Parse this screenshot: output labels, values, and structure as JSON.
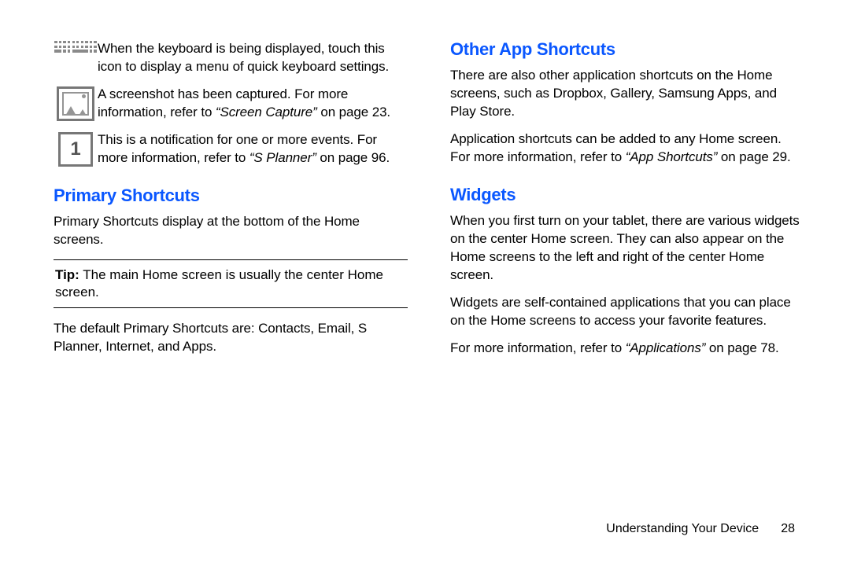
{
  "left": {
    "icons": [
      {
        "name": "keyboard-icon",
        "text_a": "When the keyboard is being displayed, touch this icon to display a menu of quick keyboard settings."
      },
      {
        "name": "screenshot-icon",
        "text_a": "A screenshot has been captured. For more information, refer to ",
        "ref": "“Screen Capture”",
        "text_b": " on page 23."
      },
      {
        "name": "event-icon",
        "num": "1",
        "text_a": "This is a notification for one or more events. For more information, refer to ",
        "ref": "“S Planner”",
        "text_b": " on page 96."
      }
    ],
    "heading": "Primary Shortcuts",
    "p1": "Primary Shortcuts display at the bottom of the Home screens.",
    "tip_label": "Tip:",
    "tip_body": " The main Home screen is usually the center Home screen.",
    "p2": "The default Primary Shortcuts are: Contacts, Email, S Planner, Internet, and Apps."
  },
  "right": {
    "h1": "Other App Shortcuts",
    "p1": "There are also other application shortcuts on the Home screens, such as Dropbox, Gallery, Samsung Apps, and Play Store.",
    "p2a": "Application shortcuts can be added to any Home screen. For more information, refer to ",
    "p2ref": "“App Shortcuts”",
    "p2b": " on page 29.",
    "h2": "Widgets",
    "p3": "When you first turn on your tablet, there are various widgets on the center Home screen. They can also appear on the Home screens to the left and right of the center Home screen.",
    "p4": "Widgets are self-contained applications that you can place on the Home screens to access your favorite features.",
    "p5a": "For more information, refer to ",
    "p5ref": "“Applications”",
    "p5b": " on page 78."
  },
  "footer": {
    "section": "Understanding Your Device",
    "page": "28"
  }
}
